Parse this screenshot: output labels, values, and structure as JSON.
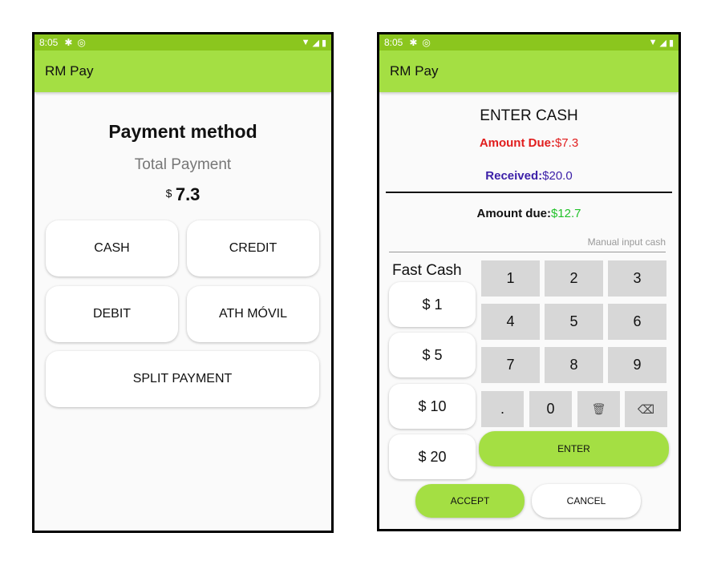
{
  "status": {
    "time": "8:05"
  },
  "app_title": "RM Pay",
  "left": {
    "heading": "Payment method",
    "total_label": "Total Payment",
    "currency": "$",
    "total_value": "7.3",
    "buttons": {
      "cash": "CASH",
      "credit": "CREDIT",
      "debit": "DEBIT",
      "ath": "ATH MÓVIL",
      "split": "SPLIT PAYMENT"
    }
  },
  "right": {
    "heading": "ENTER CASH",
    "amount_due_label": "Amount Due:",
    "amount_due_value": "$7.3",
    "received_label": "Received:",
    "received_value": "$20.0",
    "change_label": "Amount due:",
    "change_value": "$12.7",
    "manual_placeholder": "Manual input cash",
    "fast_cash_label": "Fast Cash",
    "fast_cash": [
      "$ 1",
      "$ 5",
      "$ 10",
      "$ 20"
    ],
    "keys": [
      "1",
      "2",
      "3",
      "4",
      "5",
      "6",
      "7",
      "8",
      "9",
      ".",
      "0"
    ],
    "enter": "ENTER",
    "accept": "ACCEPT",
    "cancel": "CANCEL"
  },
  "colors": {
    "status_bar": "#8bc61e",
    "app_bar": "#a4df43",
    "amount_due": "#e11d1d",
    "received": "#3b1fa8",
    "change": "#22c22a"
  }
}
